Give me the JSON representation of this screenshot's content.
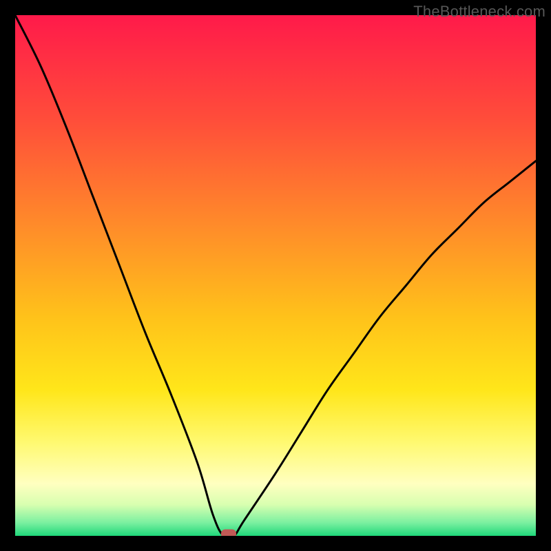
{
  "watermark": "TheBottleneck.com",
  "chart_data": {
    "type": "line",
    "title": "",
    "xlabel": "",
    "ylabel": "",
    "xlim": [
      0,
      100
    ],
    "ylim": [
      0,
      100
    ],
    "grid": false,
    "legend": false,
    "series": [
      {
        "name": "bottleneck-curve",
        "x": [
          0,
          5,
          10,
          15,
          20,
          25,
          30,
          35,
          38,
          40,
          42,
          44,
          50,
          55,
          60,
          65,
          70,
          75,
          80,
          85,
          90,
          95,
          100
        ],
        "y": [
          100,
          90,
          78,
          65,
          52,
          39,
          27,
          14,
          4,
          0,
          0,
          3,
          12,
          20,
          28,
          35,
          42,
          48,
          54,
          59,
          64,
          68,
          72
        ]
      }
    ],
    "annotations": [
      {
        "name": "optimal-marker",
        "x": 41,
        "y": 0,
        "shape": "pill",
        "color": "#c05a56"
      }
    ],
    "background_gradient": {
      "type": "vertical",
      "stops": [
        {
          "offset": 0.0,
          "color": "#ff1a4a"
        },
        {
          "offset": 0.2,
          "color": "#ff4d3a"
        },
        {
          "offset": 0.4,
          "color": "#ff8a2a"
        },
        {
          "offset": 0.58,
          "color": "#ffc21a"
        },
        {
          "offset": 0.72,
          "color": "#ffe61a"
        },
        {
          "offset": 0.82,
          "color": "#fff970"
        },
        {
          "offset": 0.9,
          "color": "#ffffc0"
        },
        {
          "offset": 0.94,
          "color": "#d8ffb0"
        },
        {
          "offset": 0.975,
          "color": "#7af0a0"
        },
        {
          "offset": 1.0,
          "color": "#1fd77a"
        }
      ]
    }
  }
}
